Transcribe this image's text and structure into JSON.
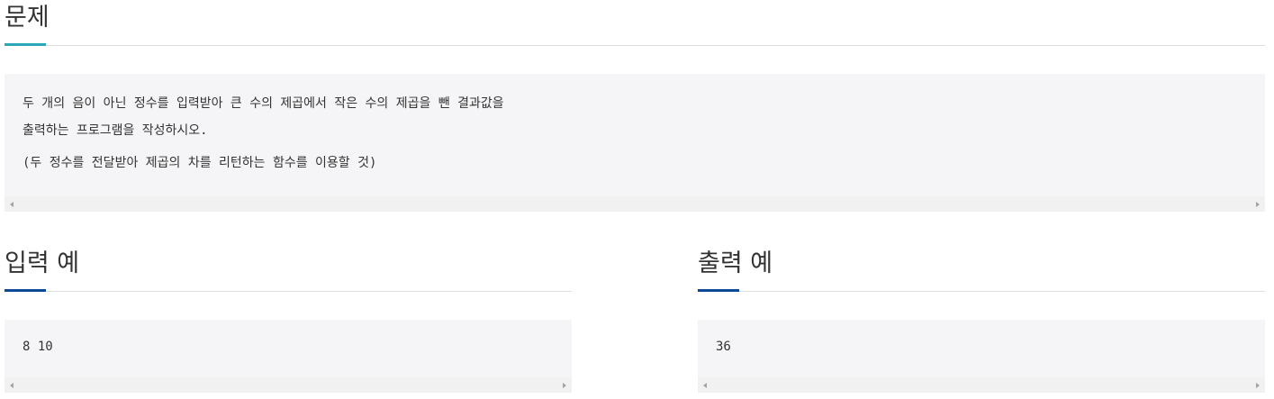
{
  "problem": {
    "title": "문제",
    "lines": [
      "두 개의 음이 아닌 정수를 입력받아 큰 수의 제곱에서 작은 수의 제곱을 뺀 결과값을",
      "출력하는 프로그램을 작성하시오.",
      "(두 정수를 전달받아 제곱의 차를 리턴하는 함수를 이용할 것)"
    ]
  },
  "input_example": {
    "title": "입력 예",
    "content": "8 10"
  },
  "output_example": {
    "title": "출력 예",
    "content": "36"
  },
  "colors": {
    "problem_accent": "#2aa7b8",
    "example_accent": "#0a4a96",
    "box_background": "#f5f5f7"
  }
}
